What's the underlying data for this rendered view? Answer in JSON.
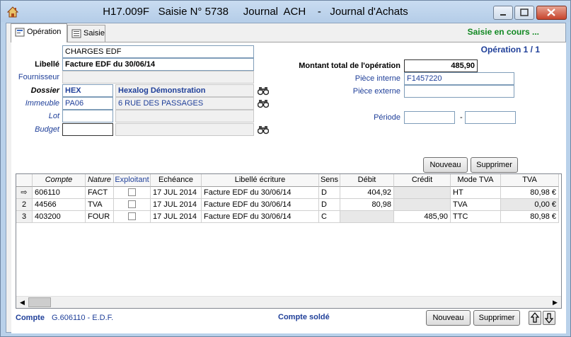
{
  "window": {
    "title": "H17.009F   Saisie N° 5738     Journal  ACH    -   Journal d'Achats"
  },
  "tabs": [
    {
      "label": "Opération",
      "active": true
    },
    {
      "label": "Saisie",
      "active": false
    }
  ],
  "status_text": "Saisie en cours ...",
  "operation_counter": "Opération 1 / 1",
  "form": {
    "header_value": "CHARGES EDF",
    "libelle_label": "Libellé",
    "libelle_value": "Facture EDF du 30/06/14",
    "fournisseur_label": "Fournisseur",
    "fournisseur_value": "",
    "dossier_label": "Dossier",
    "dossier_code": "HEX",
    "dossier_name": "Hexalog Démonstration",
    "immeuble_label": "Immeuble",
    "immeuble_code": "PA06",
    "immeuble_name": "6 RUE DES PASSAGES",
    "lot_label": "Lot",
    "lot_code": "",
    "lot_name": "",
    "budget_label": "Budget",
    "budget_code": "",
    "budget_name": "",
    "montant_label": "Montant total de l'opération",
    "montant_value": "485,90",
    "piece_interne_label": "Pièce interne",
    "piece_interne_value": "F1457220",
    "piece_externe_label": "Pièce externe",
    "piece_externe_value": "",
    "periode_label": "Période",
    "periode_sep": "-",
    "periode_from": "",
    "periode_to": ""
  },
  "buttons": {
    "nouveau": "Nouveau",
    "supprimer": "Supprimer"
  },
  "grid": {
    "columns": [
      "",
      "Compte",
      "Nature",
      "Exploitant",
      "Echéance",
      "Libellé écriture",
      "Sens",
      "Débit",
      "Crédit",
      "Mode TVA",
      "TVA"
    ],
    "rows": [
      {
        "indicator": "⇨",
        "compte": "606110",
        "nature": "FACT",
        "exploitant": false,
        "echeance": "17 JUL 2014",
        "libelle": "Facture EDF du 30/06/14",
        "sens": "D",
        "debit": "404,92",
        "credit": "",
        "mode_tva": "HT",
        "tva": "80,98 €"
      },
      {
        "indicator": "2",
        "compte": "44566",
        "nature": "TVA",
        "exploitant": false,
        "echeance": "17 JUL 2014",
        "libelle": "Facture EDF du 30/06/14",
        "sens": "D",
        "debit": "80,98",
        "credit": "",
        "mode_tva": "TVA",
        "tva": "0,00 €"
      },
      {
        "indicator": "3",
        "compte": "403200",
        "nature": "FOUR",
        "exploitant": false,
        "echeance": "17 JUL 2014",
        "libelle": "Facture EDF du 30/06/14",
        "sens": "C",
        "debit": "",
        "credit": "485,90",
        "mode_tva": "TTC",
        "tva": "80,98 €"
      }
    ]
  },
  "footer": {
    "compte_label": "Compte",
    "compte_value": "G.606110 - E.D.F.",
    "solde_text": "Compte soldé",
    "nouveau": "Nouveau",
    "supprimer": "Supprimer"
  },
  "colors": {
    "accent_blue": "#1f3f99",
    "status_green": "#118822"
  }
}
